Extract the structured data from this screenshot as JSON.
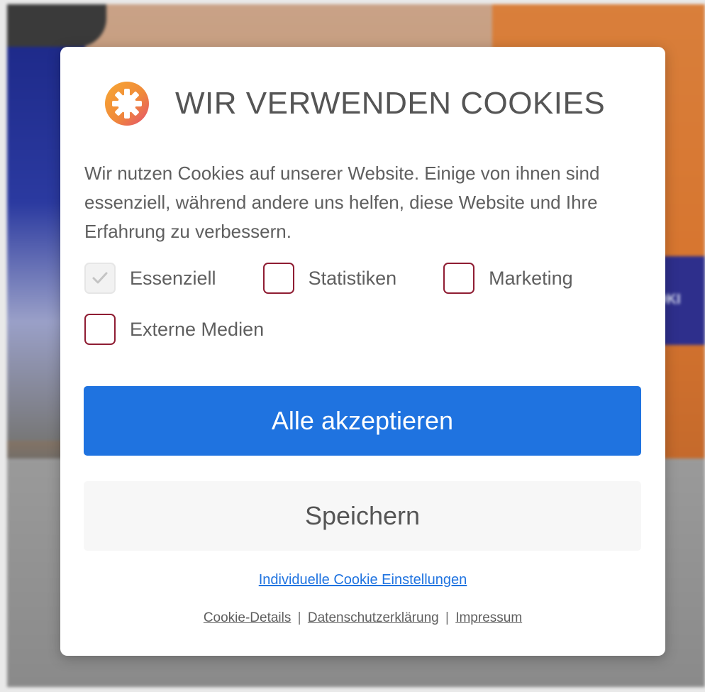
{
  "backdrop": {
    "banner_text": "OKI"
  },
  "dialog": {
    "logo_icon": "cookie-gear-logo-icon",
    "title": "WIR VERWENDEN COOKIES",
    "description": "Wir nutzen Cookies auf unserer Website. Einige von ihnen sind essenziell, während andere uns helfen, diese Website und Ihre Erfahrung zu verbessern.",
    "checkboxes": [
      {
        "label": "Essenziell",
        "checked": true,
        "disabled": true
      },
      {
        "label": "Statistiken",
        "checked": false,
        "disabled": false
      },
      {
        "label": "Marketing",
        "checked": false,
        "disabled": false
      },
      {
        "label": "Externe Medien",
        "checked": false,
        "disabled": false
      }
    ],
    "accept_all_label": "Alle akzeptieren",
    "save_label": "Speichern",
    "individual_settings_label": "Individuelle Cookie Einstellungen",
    "footer": {
      "cookie_details": "Cookie-Details",
      "privacy": "Datenschutzerklärung",
      "imprint": "Impressum",
      "separator": "|"
    },
    "colors": {
      "accent": "#1f73e0",
      "checkbox_border": "#8f1d33",
      "logo_orange": "#f2952e",
      "logo_pink": "#e2506b"
    }
  }
}
